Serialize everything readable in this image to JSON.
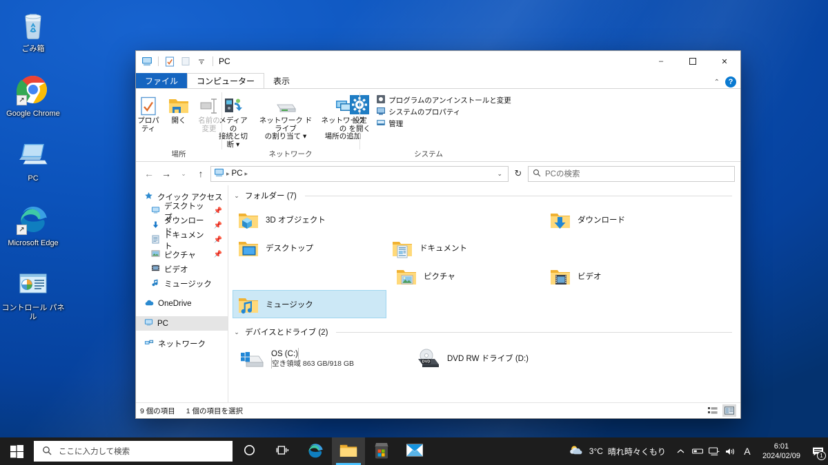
{
  "desktop": {
    "icons": [
      {
        "label": "ごみ箱",
        "icon": "recycle-bin-icon",
        "shortcut": false
      },
      {
        "label": "Google Chrome",
        "icon": "google-chrome-icon",
        "shortcut": true
      },
      {
        "label": "PC",
        "icon": "this-pc-icon",
        "shortcut": false
      },
      {
        "label": "Microsoft Edge",
        "icon": "microsoft-edge-icon",
        "shortcut": true
      },
      {
        "label": "コントロール パネル",
        "icon": "control-panel-icon",
        "shortcut": false
      }
    ],
    "background_color": "#0a4fb5"
  },
  "window": {
    "title": "PC",
    "quick_access": [
      {
        "name": "this-pc-icon"
      },
      {
        "name": "properties-icon"
      },
      {
        "name": "new-folder-icon"
      },
      {
        "name": "customize-dropdown-icon"
      }
    ],
    "caption": {
      "minimize": "–",
      "maximize": "☐",
      "close": "✕"
    },
    "ribbon_collapse": "⌃",
    "help": "?"
  },
  "tabs": [
    {
      "label": "ファイル",
      "type": "file"
    },
    {
      "label": "コンピューター",
      "type": "active"
    },
    {
      "label": "表示",
      "type": "plain"
    }
  ],
  "ribbon": {
    "groups": [
      {
        "name": "場所",
        "buttons": [
          {
            "label": "プロパティ",
            "icon": "properties-icon",
            "disabled": false
          },
          {
            "label": "開く",
            "icon": "open-folder-icon",
            "disabled": false
          },
          {
            "label": "名前の\n変更",
            "line1": "名前の",
            "line2": "変更",
            "icon": "rename-icon",
            "disabled": true
          }
        ]
      },
      {
        "name": "ネットワーク",
        "buttons": [
          {
            "line1": "メディアの",
            "line2": "接続と切断 ▾",
            "icon": "media-connect-icon",
            "disabled": false
          },
          {
            "line1": "ネットワーク ドライブ",
            "line2": "の割り当て ▾",
            "icon": "map-network-drive-icon",
            "disabled": false
          },
          {
            "line1": "ネットワークの",
            "line2": "場所の追加",
            "icon": "add-network-location-icon",
            "disabled": false
          }
        ]
      },
      {
        "name": "システム",
        "buttons": [
          {
            "line1": "設定",
            "line2": "を開く",
            "icon": "settings-gear-icon",
            "disabled": false
          }
        ],
        "small_items": [
          {
            "label": "プログラムのアンインストールと変更",
            "icon": "uninstall-program-icon"
          },
          {
            "label": "システムのプロパティ",
            "icon": "system-properties-icon"
          },
          {
            "label": "管理",
            "icon": "manage-icon"
          }
        ]
      }
    ]
  },
  "addressbar": {
    "back": "←",
    "forward": "→",
    "recent": "⌄",
    "up": "↑",
    "crumb_root_icon": "this-pc-icon",
    "crumbs": [
      "PC"
    ],
    "dropdown": "⌄",
    "refresh": "↻",
    "search_placeholder": "PCの検索",
    "search_value": ""
  },
  "navpane": {
    "items": [
      {
        "label": "クイック アクセス",
        "icon": "quick-access-star-icon",
        "child": false,
        "pinned": false,
        "selected": false
      },
      {
        "label": "デスクトップ",
        "icon": "desktop-icon",
        "child": true,
        "pinned": true,
        "selected": false
      },
      {
        "label": "ダウンロード",
        "icon": "downloads-icon",
        "child": true,
        "pinned": true,
        "selected": false
      },
      {
        "label": "ドキュメント",
        "icon": "documents-icon",
        "child": true,
        "pinned": true,
        "selected": false
      },
      {
        "label": "ピクチャ",
        "icon": "pictures-icon",
        "child": true,
        "pinned": true,
        "selected": false
      },
      {
        "label": "ビデオ",
        "icon": "videos-icon",
        "child": true,
        "pinned": false,
        "selected": false
      },
      {
        "label": "ミュージック",
        "icon": "music-icon",
        "child": true,
        "pinned": false,
        "selected": false
      },
      {
        "label": "OneDrive",
        "icon": "onedrive-cloud-icon",
        "child": false,
        "pinned": false,
        "selected": false,
        "gap_before": true
      },
      {
        "label": "PC",
        "icon": "this-pc-icon",
        "child": false,
        "pinned": false,
        "selected": true,
        "gap_before": true
      },
      {
        "label": "ネットワーク",
        "icon": "network-icon",
        "child": false,
        "pinned": false,
        "selected": false,
        "gap_before": true
      }
    ]
  },
  "content": {
    "folders_group": {
      "title": "フォルダー (7)",
      "twisty": "⌄"
    },
    "folders": [
      {
        "name": "3D オブジェクト",
        "icon": "folder-3d-objects-icon",
        "selected": false
      },
      {
        "name": "ダウンロード",
        "icon": "folder-downloads-icon",
        "selected": false
      },
      {
        "name": "デスクトップ",
        "icon": "folder-desktop-icon",
        "selected": false
      },
      {
        "name": "ドキュメント",
        "icon": "folder-documents-icon",
        "selected": false
      },
      {
        "name": "ピクチャ",
        "icon": "folder-pictures-icon",
        "selected": false
      },
      {
        "name": "ビデオ",
        "icon": "folder-videos-icon",
        "selected": false
      },
      {
        "name": "ミュージック",
        "icon": "folder-music-icon",
        "selected": true
      }
    ],
    "drives_group": {
      "title": "デバイスとドライブ (2)",
      "twisty": "⌄"
    },
    "drives": [
      {
        "name": "OS (C:)",
        "icon": "windows-drive-icon",
        "free_text": "空き領域 863 GB/918 GB",
        "used_percent": 6,
        "has_bar": true
      },
      {
        "name": "DVD RW ドライブ (D:)",
        "icon": "dvd-drive-icon",
        "has_bar": false
      }
    ]
  },
  "statusbar": {
    "item_count": "9 個の項目",
    "selection": "1 個の項目を選択",
    "views": [
      {
        "name": "details-view-button",
        "active": false
      },
      {
        "name": "large-icons-view-button",
        "active": true
      }
    ]
  },
  "taskbar": {
    "start": "start-button",
    "search_placeholder": "ここに入力して検索",
    "buttons": [
      {
        "name": "cortana-button",
        "icon": "cortana-circle-icon",
        "active": false
      },
      {
        "name": "task-view-button",
        "icon": "task-view-icon",
        "active": false
      },
      {
        "name": "edge-button",
        "icon": "microsoft-edge-icon",
        "active": false
      },
      {
        "name": "file-explorer-button",
        "icon": "file-explorer-icon",
        "active": true
      },
      {
        "name": "microsoft-store-button",
        "icon": "microsoft-store-icon",
        "active": false
      },
      {
        "name": "mail-button",
        "icon": "mail-icon",
        "active": false
      }
    ],
    "weather": {
      "temperature": "3°C",
      "condition": "晴れ時々くもり",
      "icon": "partly-cloudy-icon"
    },
    "tray": [
      {
        "name": "show-hidden-icons-button",
        "glyph": "⌃"
      },
      {
        "name": "removable-media-icon",
        "glyph": "▭"
      },
      {
        "name": "network-icon",
        "glyph": "🖵"
      },
      {
        "name": "volume-icon",
        "glyph": "🔊"
      },
      {
        "name": "ime-indicator",
        "glyph": "A"
      }
    ],
    "clock": {
      "time": "6:01",
      "date": "2024/02/09"
    },
    "notifications": {
      "count": "1"
    }
  }
}
